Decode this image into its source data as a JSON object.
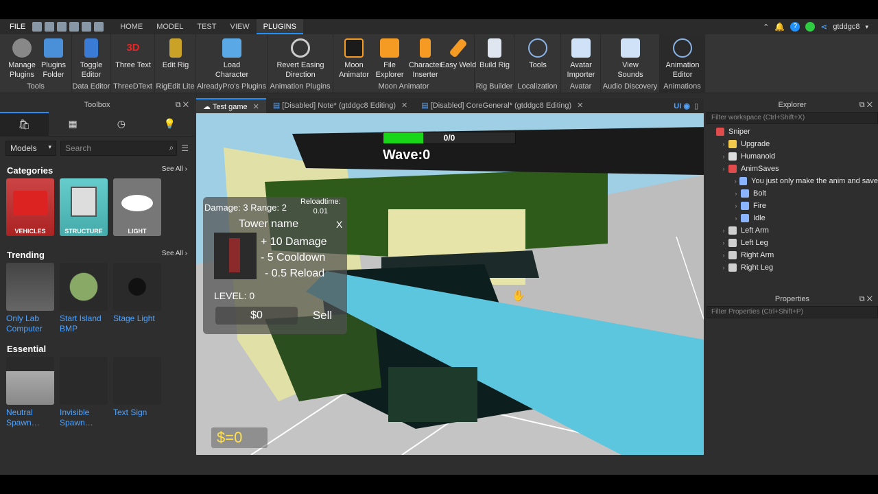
{
  "menubar": {
    "file": "FILE",
    "tabs": [
      "HOME",
      "MODEL",
      "TEST",
      "VIEW",
      "PLUGINS"
    ],
    "active_tab": "PLUGINS",
    "user": "gtddgc8"
  },
  "ribbon": {
    "groups": [
      {
        "label": "Tools",
        "buttons": [
          "Manage Plugins",
          "Plugins Folder"
        ]
      },
      {
        "label": "Data Editor",
        "buttons": [
          "Toggle Editor"
        ]
      },
      {
        "label": "ThreeDText",
        "buttons": [
          "Three Text"
        ]
      },
      {
        "label": "RigEdit Lite",
        "buttons": [
          "Edit Rig"
        ]
      },
      {
        "label": "AlreadyPro's Plugins",
        "buttons": [
          "Load Character"
        ]
      },
      {
        "label": "Animation Plugins",
        "buttons": [
          "Revert Easing Direction"
        ]
      },
      {
        "label": "Moon Animator",
        "buttons": [
          "Moon Animator",
          "File Explorer",
          "Character Inserter",
          "Easy Weld"
        ]
      },
      {
        "label": "Rig Builder",
        "buttons": [
          "Build Rig"
        ]
      },
      {
        "label": "Localization",
        "buttons": [
          "Tools"
        ]
      },
      {
        "label": "Avatar",
        "buttons": [
          "Avatar Importer"
        ]
      },
      {
        "label": "Audio Discovery",
        "buttons": [
          "View Sounds"
        ]
      },
      {
        "label": "Animations",
        "buttons": [
          "Animation Editor"
        ]
      }
    ],
    "colors": {
      "accent": "#1e90ff",
      "moon": "#f59a23"
    }
  },
  "toolbox": {
    "title": "Toolbox",
    "model_select": "Models",
    "search_placeholder": "Search",
    "categories_title": "Categories",
    "see_all": "See All",
    "categories": [
      "VEHICLES",
      "STRUCTURE",
      "LIGHT"
    ],
    "trending_title": "Trending",
    "trending": [
      "Only Lab Computer",
      "Start Island BMP",
      "Stage Light"
    ],
    "essential_title": "Essential",
    "essential": [
      "Neutral Spawn…",
      "Invisible Spawn…",
      "Text Sign"
    ]
  },
  "doc_tabs": [
    {
      "label": "Test game",
      "active": true
    },
    {
      "label": "[Disabled] Note* (gtddgc8 Editing)",
      "active": false
    },
    {
      "label": "[Disabled] CoreGeneral* (gtddgc8 Editing)",
      "active": false
    }
  ],
  "ui_toggle": "UI",
  "game": {
    "health_text": "0/0",
    "health_fraction": 0.3,
    "wave": "Wave:0",
    "damage": "Damage: 3",
    "range": "Range: 2",
    "reload_label": "Reloadtime:",
    "reload_value": "0.01",
    "tower_name": "Tower name",
    "close": "X",
    "upgrades": [
      "+ 10 Damage",
      "- 5 Cooldown",
      "- 0.5 Reload"
    ],
    "level": "LEVEL: 0",
    "price": "$0",
    "sell": "Sell",
    "money": "$=0"
  },
  "explorer": {
    "title": "Explorer",
    "filter_placeholder": "Filter workspace (Ctrl+Shift+X)",
    "items": [
      {
        "label": "Sniper",
        "depth": 0,
        "icon": "model-icon"
      },
      {
        "label": "Upgrade",
        "depth": 1,
        "icon": "folder-icon"
      },
      {
        "label": "Humanoid",
        "depth": 1,
        "icon": "humanoid-icon"
      },
      {
        "label": "AnimSaves",
        "depth": 1,
        "icon": "model-icon"
      },
      {
        "label": "You just only make the anim and save",
        "depth": 2,
        "icon": "keyframe-icon"
      },
      {
        "label": "Bolt",
        "depth": 2,
        "icon": "keyframe-icon"
      },
      {
        "label": "Fire",
        "depth": 2,
        "icon": "keyframe-icon"
      },
      {
        "label": "Idle",
        "depth": 2,
        "icon": "keyframe-icon"
      },
      {
        "label": "Left Arm",
        "depth": 1,
        "icon": "part-icon"
      },
      {
        "label": "Left Leg",
        "depth": 1,
        "icon": "part-icon"
      },
      {
        "label": "Right Arm",
        "depth": 1,
        "icon": "part-icon"
      },
      {
        "label": "Right Leg",
        "depth": 1,
        "icon": "part-icon"
      }
    ]
  },
  "properties": {
    "title": "Properties",
    "filter_placeholder": "Filter Properties (Ctrl+Shift+P)"
  }
}
